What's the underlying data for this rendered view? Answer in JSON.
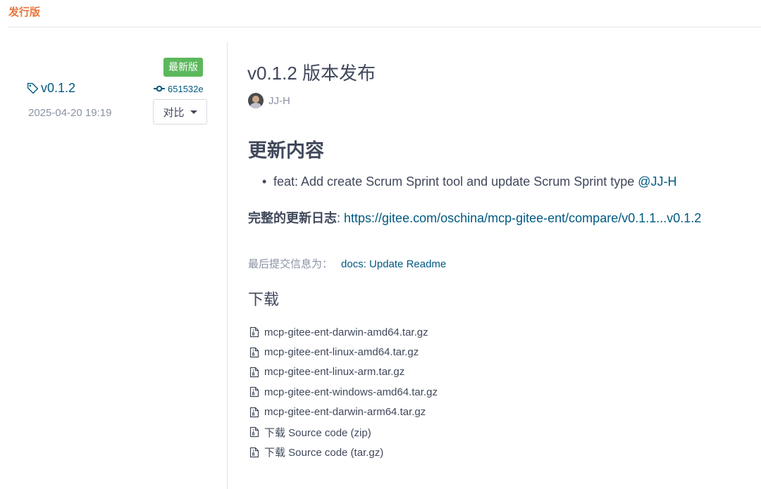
{
  "tabs": {
    "releases": "发行版"
  },
  "release": {
    "latest_badge": "最新版",
    "tag": "v0.1.2",
    "commit": "651532e",
    "date": "2025-04-20 19:19",
    "compare_label": "对比",
    "title": "v0.1.2 版本发布",
    "author": "JJ-H"
  },
  "notes": {
    "heading": "更新内容",
    "items": [
      {
        "text": "feat: Add create Scrum Sprint tool and update Scrum Sprint type ",
        "mention": "@JJ-H"
      }
    ],
    "changelog_label": "完整的更新日志",
    "changelog_sep": ": ",
    "changelog_url": "https://gitee.com/oschina/mcp-gitee-ent/compare/v0.1.1...v0.1.2"
  },
  "last_commit": {
    "label": "最后提交信息为：",
    "message": "docs: Update Readme"
  },
  "downloads": {
    "heading": "下载",
    "files": [
      "mcp-gitee-ent-darwin-amd64.tar.gz",
      "mcp-gitee-ent-linux-amd64.tar.gz",
      "mcp-gitee-ent-linux-arm.tar.gz",
      "mcp-gitee-ent-windows-amd64.tar.gz",
      "mcp-gitee-ent-darwin-arm64.tar.gz",
      "下载 Source code (zip)",
      "下载 Source code (tar.gz)"
    ]
  },
  "colors": {
    "accent_tab": "#e8773a",
    "link": "#005980",
    "badge_green": "#5cb85c",
    "muted_text": "#8c92a4"
  }
}
